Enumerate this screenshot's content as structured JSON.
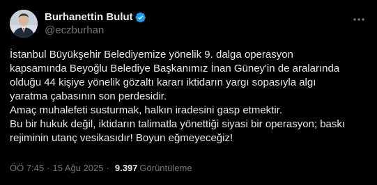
{
  "author": {
    "display_name": "Burhanettin Bulut",
    "handle": "@eczburhan",
    "verified": true,
    "verified_color": "#1d9bf0"
  },
  "tweet": {
    "text": "İstanbul Büyükşehir Belediyemize yönelik 9. dalga operasyon\nkapsamında Beyoğlu Belediye Başkanımız İnan Güney'in de aralarında\nolduğu 44 kişiye yönelik gözaltı kararı iktidarın yargı sopasıyla algı\nyaratma çabasının son perdesidir.\nAmaç muhalefeti susturmak, halkın iradesini gasp etmektir.\nBu bir hukuk değil, iktidarın talimatla yönettiği siyasi bir operasyon; baskı\nrejiminin utanç vesikasıdır!  Boyun eğmeyeceğiz!"
  },
  "meta": {
    "time": "ÖÖ 7:45",
    "separator": "·",
    "date": "15 Ağu 2025",
    "views_count": "9.397",
    "views_label": "Görüntüleme"
  },
  "icons": {
    "verified": "verified-badge-icon",
    "more": "more-options-icon"
  },
  "colors": {
    "background": "#000000",
    "primary_text": "#e7e9ea",
    "secondary_text": "#71767b"
  }
}
